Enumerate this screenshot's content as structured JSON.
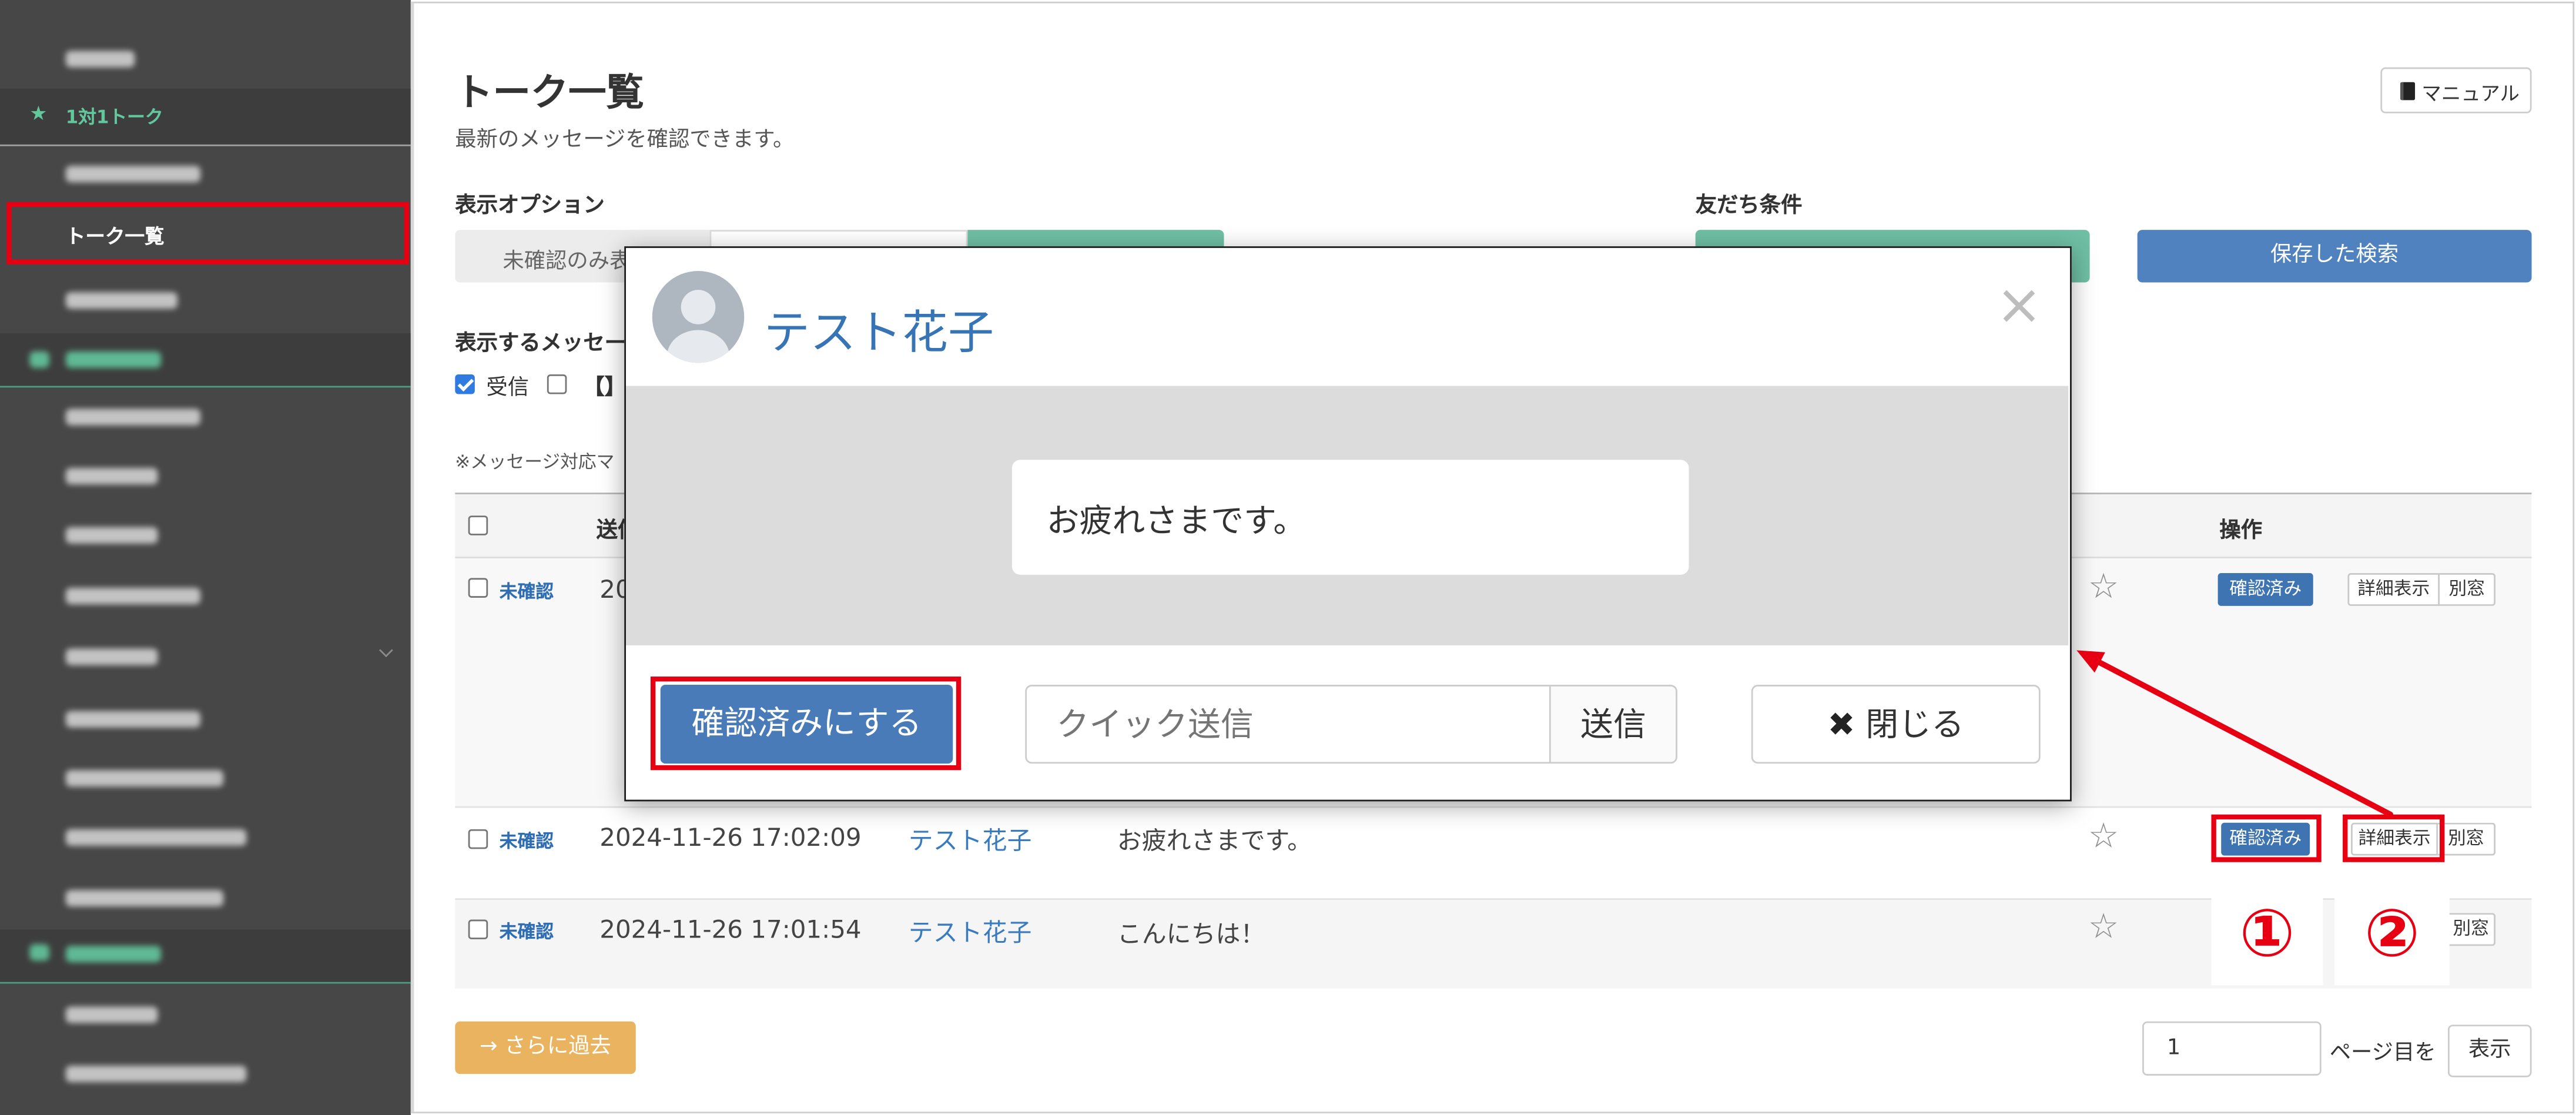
{
  "colors": {
    "sidebar_bg": "#474747",
    "teal": "#6fbfa4",
    "section_green": "#63c79e",
    "primary_blue": "#4a7bb9",
    "link_blue": "#3a7bc0",
    "annotation_red": "#e60012",
    "orange": "#e9b35f"
  },
  "icons": {
    "section_star": "★",
    "star": "☆",
    "close": "×",
    "x_mark": "✖"
  },
  "sidebar": {
    "section_1on1": "1対1トーク",
    "active_item": "トーク一覧"
  },
  "header": {
    "title": "トーク一覧",
    "subtitle": "最新のメッセージを確認できます。",
    "manual_button": "マニュアル"
  },
  "display_options": {
    "label": "表示オプション",
    "unconfirmed_only": "未確認のみ表"
  },
  "friend_conditions": {
    "label": "友だち条件"
  },
  "saved_search_button": "保存した検索",
  "message_filter": {
    "label": "表示するメッセー",
    "received_label": "受信",
    "received_checked": true,
    "other_label": "【】",
    "other_checked": false
  },
  "note": "※メッセージ対応マ",
  "table": {
    "columns": {
      "sent": "送信",
      "actions": "操作"
    },
    "rows": [
      {
        "status": "未確認",
        "datetime": "20",
        "confirm": "確認済み",
        "detail": "詳細表示",
        "new_window": "別窓"
      },
      {
        "status": "未確認",
        "datetime": "2024-11-26 17:02:09",
        "name": "テスト花子",
        "message": "お疲れさまです。",
        "confirm": "確認済み",
        "detail": "詳細表示",
        "new_window": "別窓"
      },
      {
        "status": "未確認",
        "datetime": "2024-11-26 17:01:54",
        "name": "テスト花子",
        "message": "こんにちは！",
        "new_window": "別窓"
      }
    ]
  },
  "pagination": {
    "older_button": "→ さらに過去",
    "page_value": "1",
    "page_suffix": "ページ目を",
    "show_button": "表示"
  },
  "modal": {
    "name": "テスト花子",
    "message": "お疲れさまです。",
    "confirm_button": "確認済みにする",
    "quick_send_placeholder": "クイック送信",
    "send_button": "送信",
    "close_button": "閉じる"
  },
  "annotations": {
    "step1": "①",
    "step2": "②"
  }
}
